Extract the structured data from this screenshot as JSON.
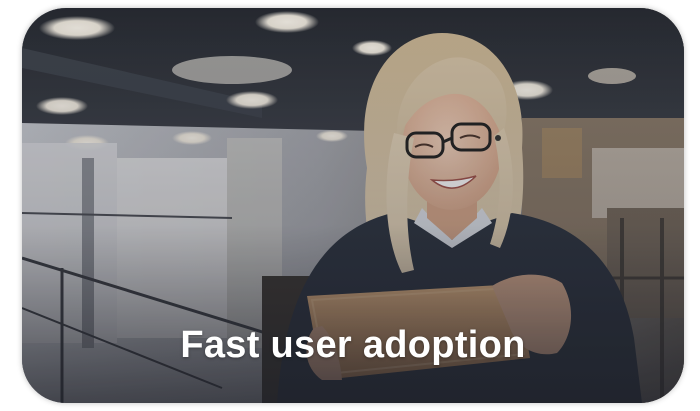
{
  "card": {
    "caption": "Fast user adoption"
  },
  "photo": {
    "subject": "smiling woman with glasses using a tablet in an office",
    "palette": {
      "ceiling": "#2a2e36",
      "light": "#fffaf0",
      "sweater": "#2b3340",
      "hair": "#d8c6a8",
      "skin": "#e8c2a8",
      "tablet": "#d9a674",
      "overlay": "#1e2028"
    }
  }
}
